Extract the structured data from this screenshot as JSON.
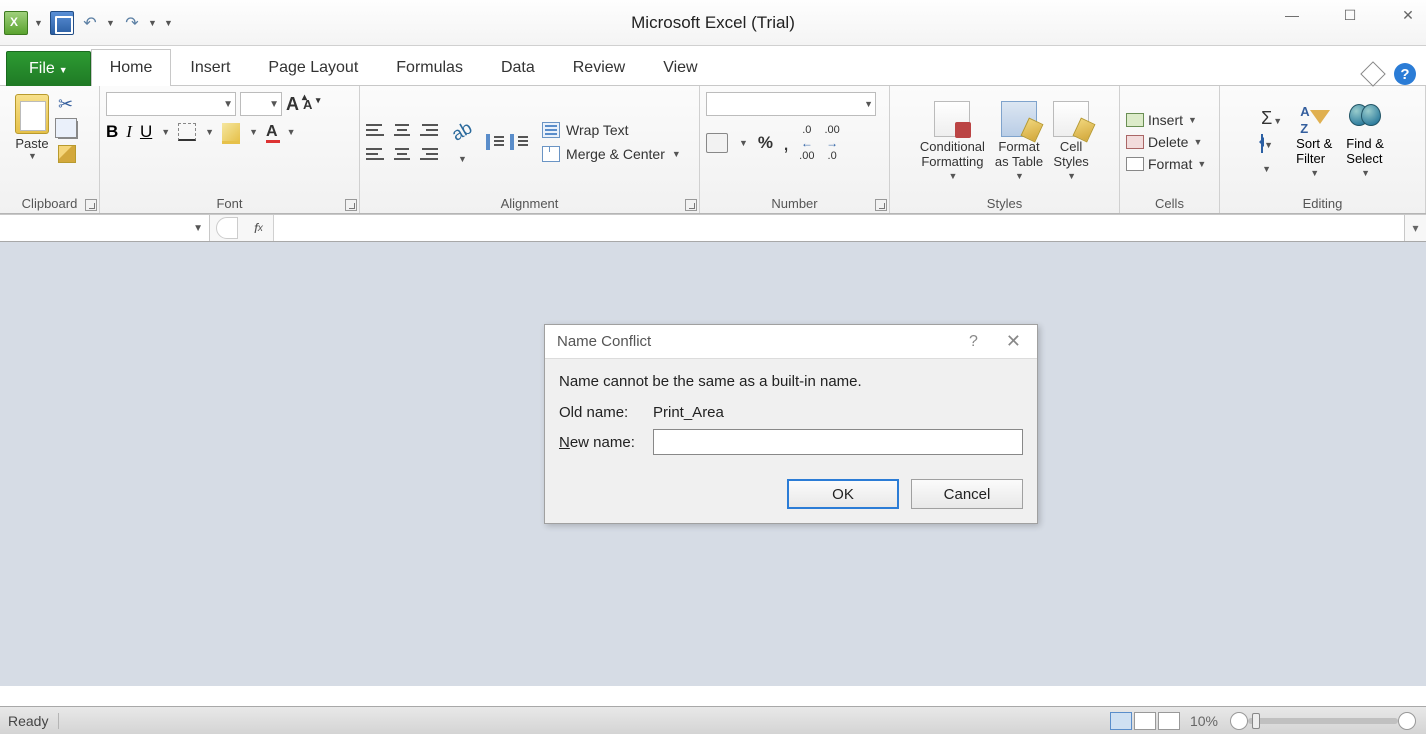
{
  "app": {
    "title": "Microsoft Excel (Trial)"
  },
  "tabs": {
    "file": "File",
    "items": [
      "Home",
      "Insert",
      "Page Layout",
      "Formulas",
      "Data",
      "Review",
      "View"
    ],
    "active": "Home"
  },
  "ribbon": {
    "clipboard": {
      "paste": "Paste",
      "label": "Clipboard"
    },
    "font": {
      "label": "Font"
    },
    "alignment": {
      "wrap": "Wrap Text",
      "merge": "Merge & Center",
      "label": "Alignment"
    },
    "number": {
      "label": "Number"
    },
    "styles": {
      "conditional": "Conditional\nFormatting",
      "formatTable": "Format\nas Table",
      "cellStyles": "Cell\nStyles",
      "label": "Styles"
    },
    "cells": {
      "insert": "Insert",
      "delete": "Delete",
      "format": "Format",
      "label": "Cells"
    },
    "editing": {
      "sort": "Sort &\nFilter",
      "find": "Find &\nSelect",
      "label": "Editing"
    }
  },
  "formulaBar": {
    "nameBox": "",
    "formula": ""
  },
  "dialog": {
    "title": "Name Conflict",
    "message": "Name cannot be the same as a built-in name.",
    "oldNameLabel": "Old name:",
    "oldNameValue": "Print_Area",
    "newNameLabel": "New name:",
    "newNameValue": "",
    "ok": "OK",
    "cancel": "Cancel"
  },
  "status": {
    "ready": "Ready",
    "zoom": "10%"
  }
}
